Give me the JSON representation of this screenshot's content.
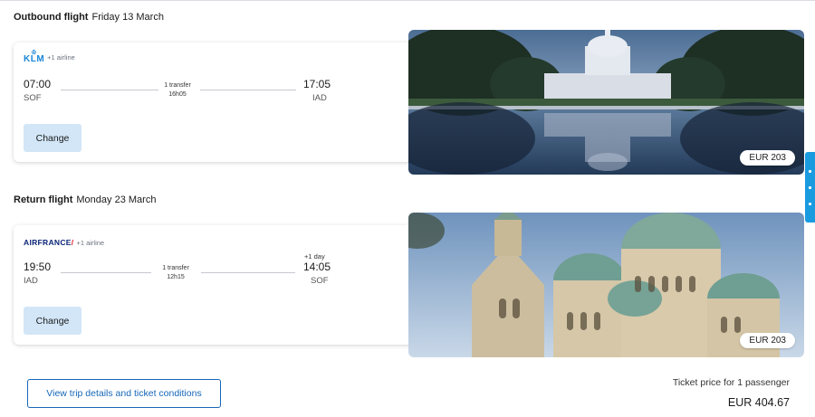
{
  "outbound": {
    "title": "Outbound flight",
    "date": "Friday 13 March",
    "airline": "KLM",
    "extra_airline": "+1 airline",
    "depart_time": "07:00",
    "depart_code": "SOF",
    "arrive_time": "17:05",
    "arrive_code": "IAD",
    "transfer": "1 transfer",
    "duration": "16h05",
    "change_label": "Change",
    "price": "EUR 203"
  },
  "return": {
    "title": "Return flight",
    "date": "Monday 23 March",
    "airline_main": "AIRFRANCE",
    "airline_slash": "/",
    "extra_airline": "+1 airline",
    "depart_time": "19:50",
    "depart_code": "IAD",
    "arrive_time": "14:05",
    "arrive_code": "SOF",
    "plus_day": "+1 day",
    "transfer": "1 transfer",
    "duration": "12h15",
    "change_label": "Change",
    "price": "EUR 203"
  },
  "footer": {
    "details_label": "View trip details and ticket conditions",
    "price_caption": "Ticket price for 1 passenger",
    "price_total": "EUR 404.67"
  },
  "colors": {
    "accent": "#1567b8",
    "button_bg": "#d2e6f7",
    "side_tab": "#1a9be0"
  }
}
